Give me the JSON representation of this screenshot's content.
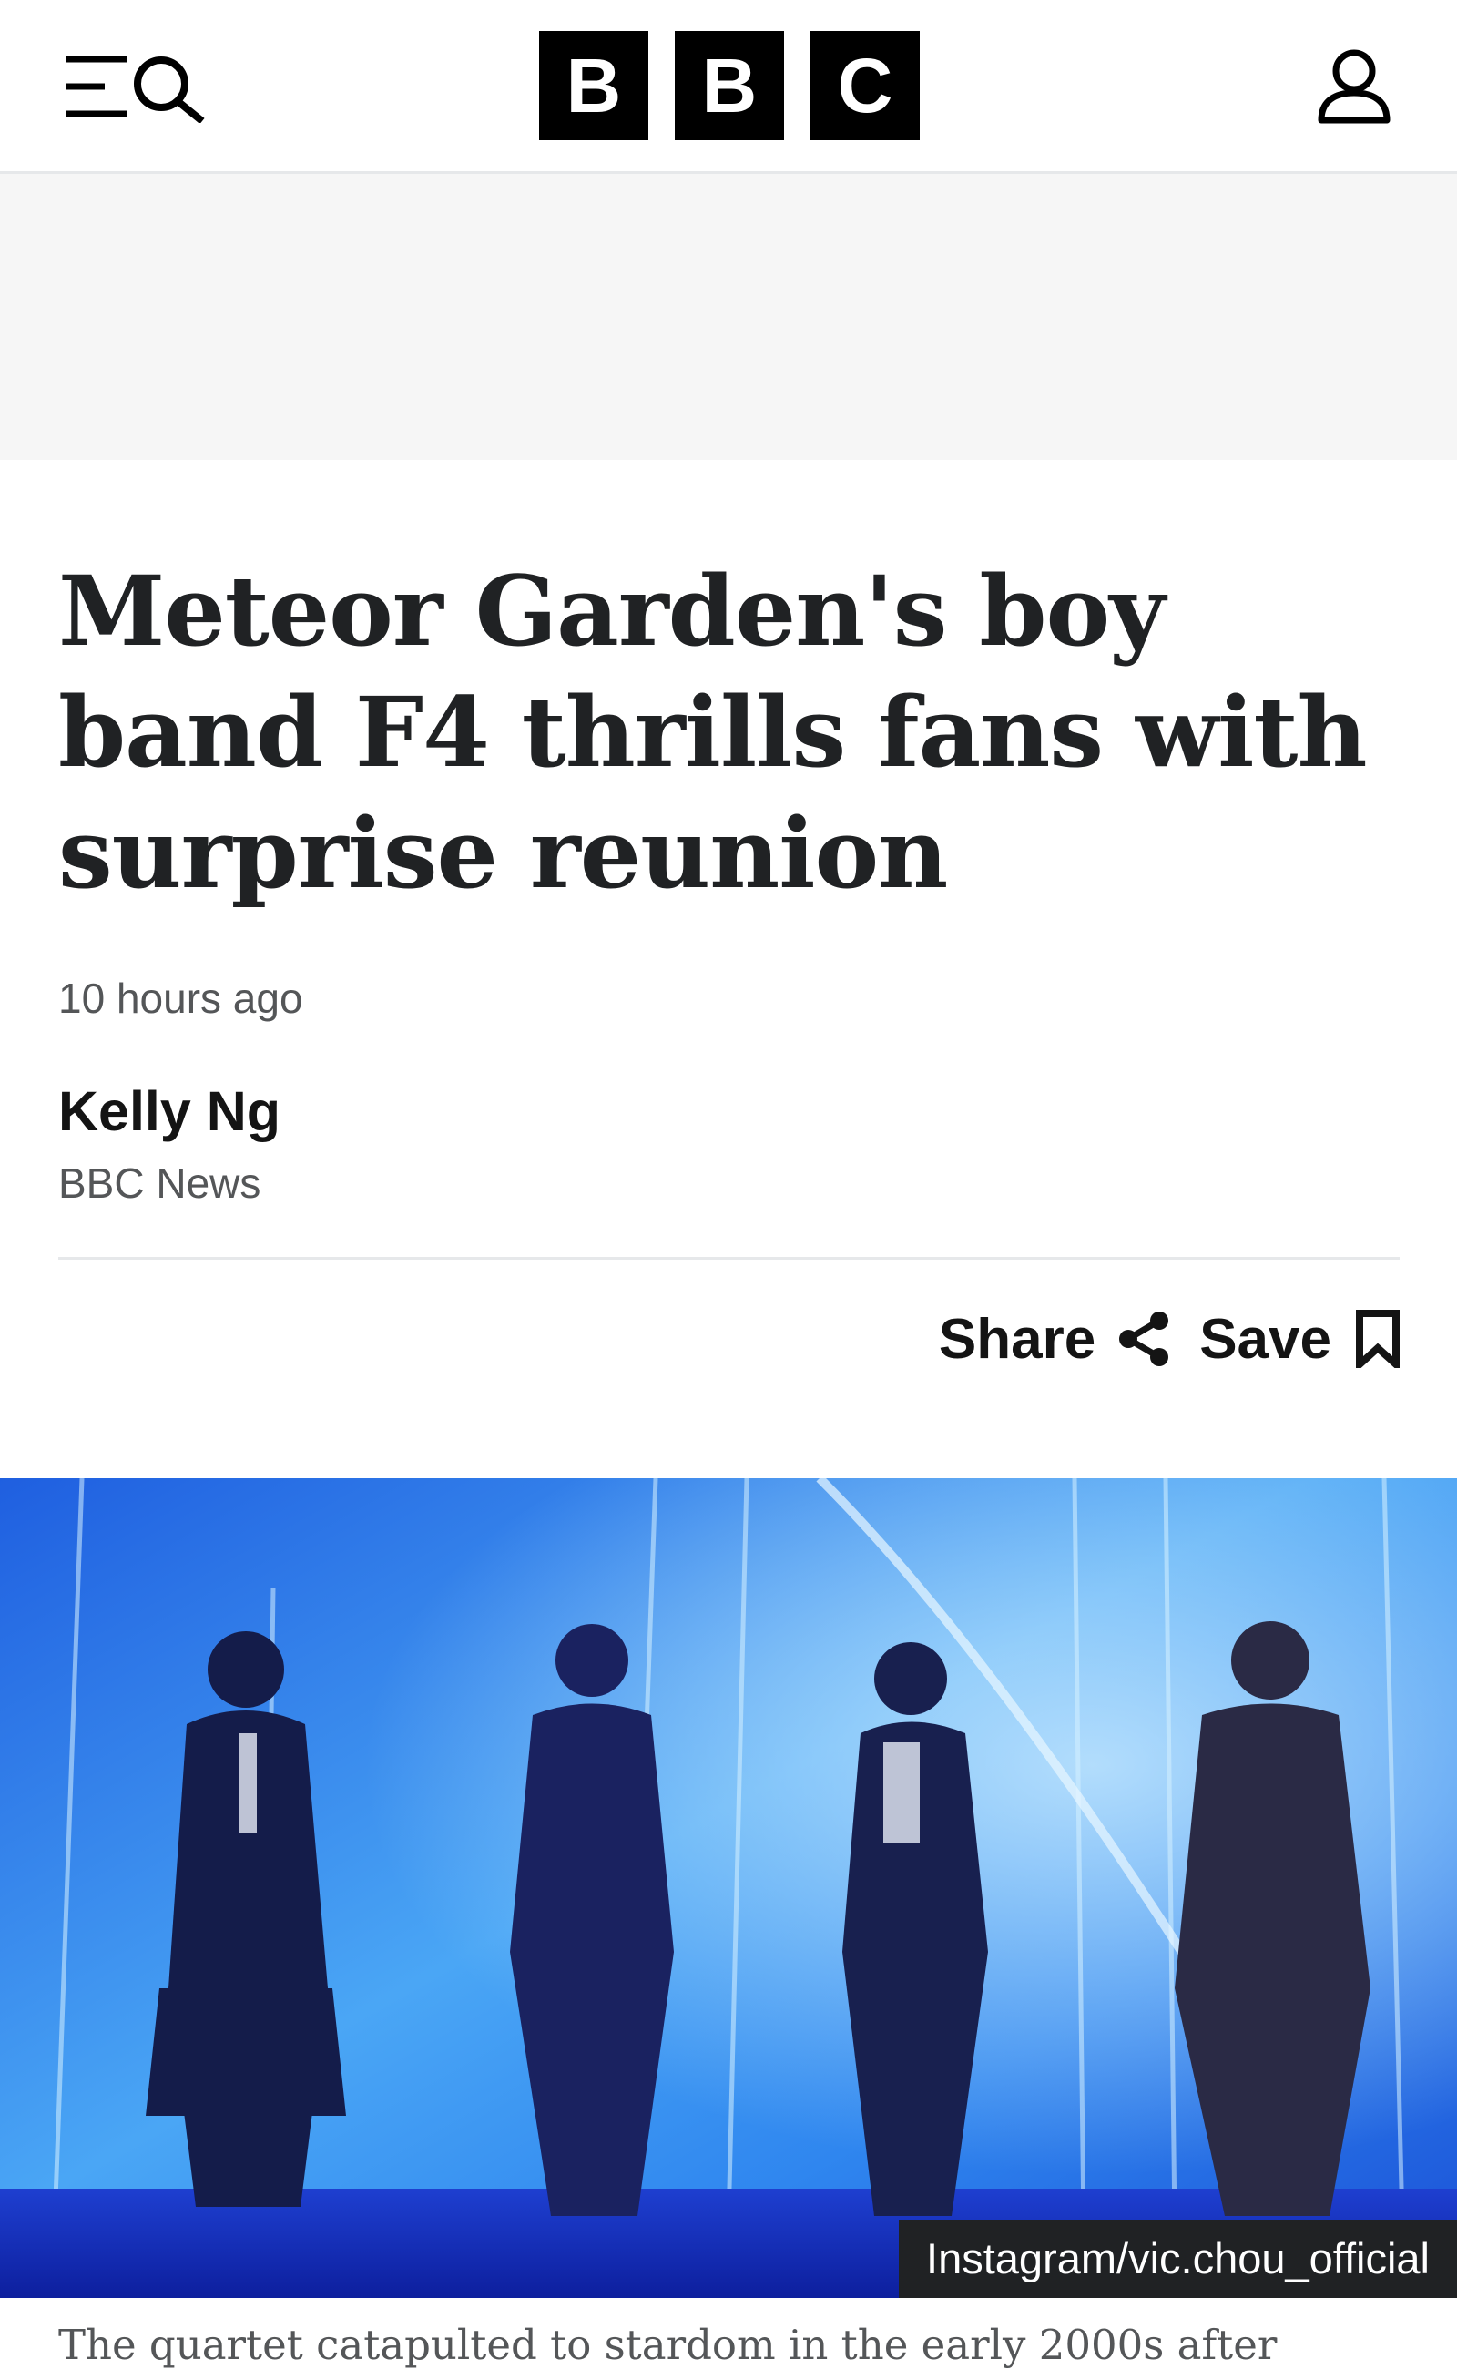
{
  "header": {
    "logo_letters": [
      "B",
      "B",
      "C"
    ],
    "menu_icon": "menu-icon",
    "search_icon": "search-icon",
    "account_icon": "account-icon"
  },
  "article": {
    "headline": "Meteor Garden's boy band F4 thrills fans with surprise reunion",
    "timestamp": "10 hours ago",
    "author": "Kelly Ng",
    "organization": "BBC News"
  },
  "actions": {
    "share_label": "Share",
    "save_label": "Save",
    "share_icon": "share-icon",
    "save_icon": "bookmark-icon"
  },
  "image": {
    "credit": "Instagram/vic.chou_official"
  },
  "caption": "The quartet catapulted to stardom in the early 2000s after",
  "colors": {
    "text": "#141414",
    "secondary_text": "#545658",
    "headline": "#202224",
    "divider": "#e6e8ea",
    "ad_background": "#f6f6f6",
    "credit_background": "#202224"
  }
}
